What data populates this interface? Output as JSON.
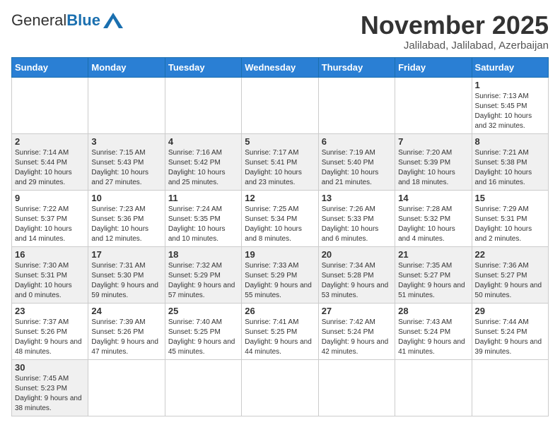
{
  "logo": {
    "general": "General",
    "blue": "Blue"
  },
  "header": {
    "month_year": "November 2025",
    "location": "Jalilabad, Jalilabad, Azerbaijan"
  },
  "days_of_week": [
    "Sunday",
    "Monday",
    "Tuesday",
    "Wednesday",
    "Thursday",
    "Friday",
    "Saturday"
  ],
  "weeks": [
    [
      null,
      null,
      null,
      null,
      null,
      null,
      {
        "day": "1",
        "sunrise": "7:13 AM",
        "sunset": "5:45 PM",
        "daylight": "10 hours and 32 minutes."
      }
    ],
    [
      {
        "day": "2",
        "sunrise": "7:14 AM",
        "sunset": "5:44 PM",
        "daylight": "10 hours and 29 minutes."
      },
      {
        "day": "3",
        "sunrise": "7:15 AM",
        "sunset": "5:43 PM",
        "daylight": "10 hours and 27 minutes."
      },
      {
        "day": "4",
        "sunrise": "7:16 AM",
        "sunset": "5:42 PM",
        "daylight": "10 hours and 25 minutes."
      },
      {
        "day": "5",
        "sunrise": "7:17 AM",
        "sunset": "5:41 PM",
        "daylight": "10 hours and 23 minutes."
      },
      {
        "day": "6",
        "sunrise": "7:19 AM",
        "sunset": "5:40 PM",
        "daylight": "10 hours and 21 minutes."
      },
      {
        "day": "7",
        "sunrise": "7:20 AM",
        "sunset": "5:39 PM",
        "daylight": "10 hours and 18 minutes."
      },
      {
        "day": "8",
        "sunrise": "7:21 AM",
        "sunset": "5:38 PM",
        "daylight": "10 hours and 16 minutes."
      }
    ],
    [
      {
        "day": "9",
        "sunrise": "7:22 AM",
        "sunset": "5:37 PM",
        "daylight": "10 hours and 14 minutes."
      },
      {
        "day": "10",
        "sunrise": "7:23 AM",
        "sunset": "5:36 PM",
        "daylight": "10 hours and 12 minutes."
      },
      {
        "day": "11",
        "sunrise": "7:24 AM",
        "sunset": "5:35 PM",
        "daylight": "10 hours and 10 minutes."
      },
      {
        "day": "12",
        "sunrise": "7:25 AM",
        "sunset": "5:34 PM",
        "daylight": "10 hours and 8 minutes."
      },
      {
        "day": "13",
        "sunrise": "7:26 AM",
        "sunset": "5:33 PM",
        "daylight": "10 hours and 6 minutes."
      },
      {
        "day": "14",
        "sunrise": "7:28 AM",
        "sunset": "5:32 PM",
        "daylight": "10 hours and 4 minutes."
      },
      {
        "day": "15",
        "sunrise": "7:29 AM",
        "sunset": "5:31 PM",
        "daylight": "10 hours and 2 minutes."
      }
    ],
    [
      {
        "day": "16",
        "sunrise": "7:30 AM",
        "sunset": "5:31 PM",
        "daylight": "10 hours and 0 minutes."
      },
      {
        "day": "17",
        "sunrise": "7:31 AM",
        "sunset": "5:30 PM",
        "daylight": "9 hours and 59 minutes."
      },
      {
        "day": "18",
        "sunrise": "7:32 AM",
        "sunset": "5:29 PM",
        "daylight": "9 hours and 57 minutes."
      },
      {
        "day": "19",
        "sunrise": "7:33 AM",
        "sunset": "5:29 PM",
        "daylight": "9 hours and 55 minutes."
      },
      {
        "day": "20",
        "sunrise": "7:34 AM",
        "sunset": "5:28 PM",
        "daylight": "9 hours and 53 minutes."
      },
      {
        "day": "21",
        "sunrise": "7:35 AM",
        "sunset": "5:27 PM",
        "daylight": "9 hours and 51 minutes."
      },
      {
        "day": "22",
        "sunrise": "7:36 AM",
        "sunset": "5:27 PM",
        "daylight": "9 hours and 50 minutes."
      }
    ],
    [
      {
        "day": "23",
        "sunrise": "7:37 AM",
        "sunset": "5:26 PM",
        "daylight": "9 hours and 48 minutes."
      },
      {
        "day": "24",
        "sunrise": "7:39 AM",
        "sunset": "5:26 PM",
        "daylight": "9 hours and 47 minutes."
      },
      {
        "day": "25",
        "sunrise": "7:40 AM",
        "sunset": "5:25 PM",
        "daylight": "9 hours and 45 minutes."
      },
      {
        "day": "26",
        "sunrise": "7:41 AM",
        "sunset": "5:25 PM",
        "daylight": "9 hours and 44 minutes."
      },
      {
        "day": "27",
        "sunrise": "7:42 AM",
        "sunset": "5:24 PM",
        "daylight": "9 hours and 42 minutes."
      },
      {
        "day": "28",
        "sunrise": "7:43 AM",
        "sunset": "5:24 PM",
        "daylight": "9 hours and 41 minutes."
      },
      {
        "day": "29",
        "sunrise": "7:44 AM",
        "sunset": "5:24 PM",
        "daylight": "9 hours and 39 minutes."
      }
    ],
    [
      {
        "day": "30",
        "sunrise": "7:45 AM",
        "sunset": "5:23 PM",
        "daylight": "9 hours and 38 minutes."
      },
      null,
      null,
      null,
      null,
      null,
      null
    ]
  ]
}
